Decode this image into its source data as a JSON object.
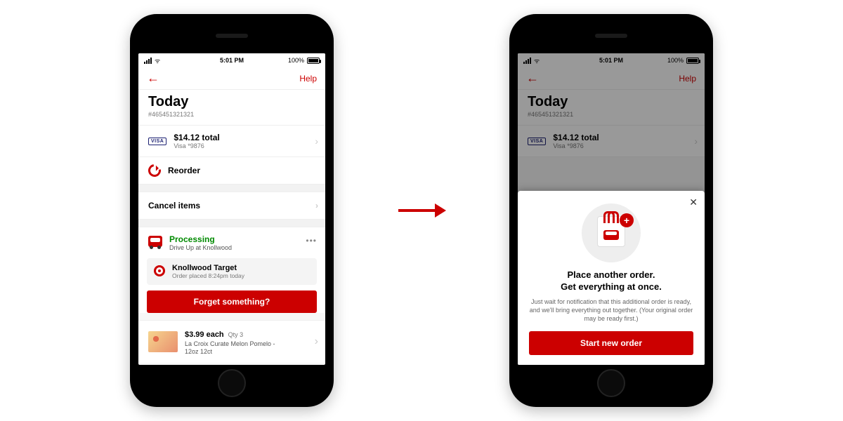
{
  "status_bar": {
    "time": "5:01 PM",
    "battery": "100%"
  },
  "nav": {
    "help": "Help"
  },
  "header": {
    "title": "Today",
    "order_number": "#465451321321"
  },
  "payment": {
    "brand": "VISA",
    "total": "$14.12 total",
    "card": "Visa *9876"
  },
  "reorder_label": "Reorder",
  "cancel_label": "Cancel items",
  "processing": {
    "status": "Processing",
    "method": "Drive Up at Knollwood",
    "store_name": "Knollwood Target",
    "placed": "Order placed 8:24pm today",
    "cta": "Forget something?"
  },
  "item": {
    "price": "$3.99 each",
    "qty": "Qty 3",
    "desc": "La Croix Curate Melon Pomelo - 12oz 12ct"
  },
  "sheet": {
    "title_line1": "Place another order.",
    "title_line2": "Get everything at once.",
    "body": "Just wait for notification that this additional order is ready, and we'll bring everything out together. (Your original order may be ready first.)",
    "cta": "Start new order"
  }
}
